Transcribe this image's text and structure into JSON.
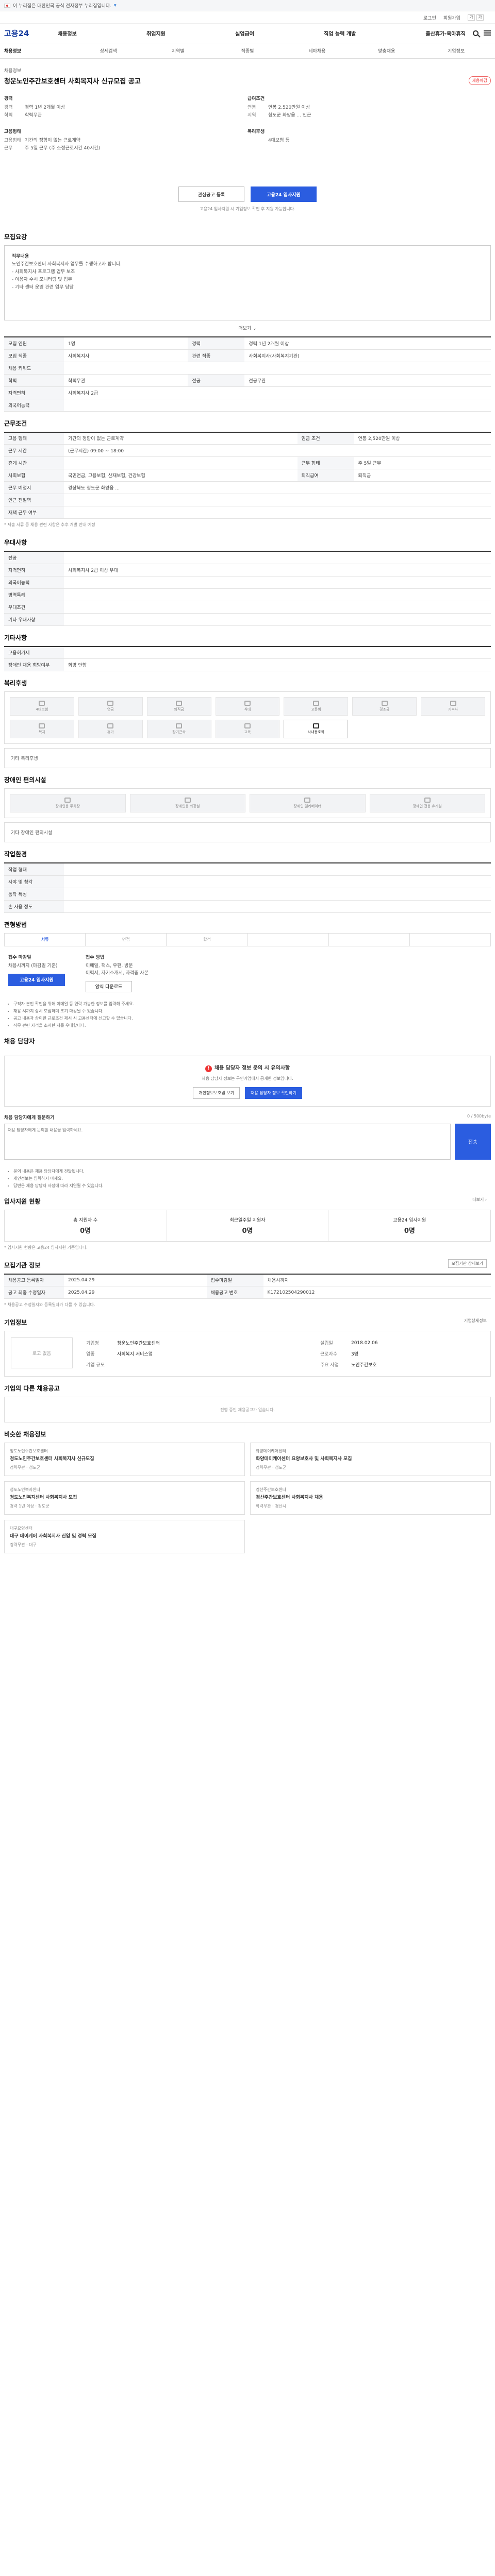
{
  "gov": {
    "text": "이 누리집은 대한민국 공식 전자정부 누리집입니다.",
    "toggle": "▾"
  },
  "util": {
    "login": "로그인",
    "join": "회원가입",
    "font": [
      "가",
      "가"
    ]
  },
  "logo": "고용24",
  "gnb": [
    "채용정보",
    "취업지원",
    "실업급여",
    "직업 능력 개발",
    "출산휴가·육아휴직"
  ],
  "tabs": [
    "채용정보",
    "상세검색",
    "지역별",
    "직종별",
    "테마채용",
    "맞춤채용",
    "기업정보"
  ],
  "title": {
    "company": "채용정보",
    "text": "청운노인주간보호센터 사회복지사 신규모집 공고",
    "badge": "채용마감"
  },
  "summary": {
    "left": [
      {
        "h": "경력",
        "v": [
          {
            "k": "경력",
            "v": "경력 1년 2개월 이상"
          },
          {
            "k": "학력",
            "v": "학력무관"
          }
        ]
      },
      {
        "h": "고용형태",
        "v": [
          {
            "k": "고용형태",
            "v": "기간의 정함이 없는 근로계약"
          },
          {
            "k": "근무",
            "v": "주 5일 근무 (주 소정근로시간 40시간)"
          }
        ]
      }
    ],
    "right": [
      {
        "h": "급여조건",
        "v": [
          {
            "k": "연봉",
            "v": "연봉 2,520만원 이상"
          },
          {
            "k": "지역",
            "v": "청도군 화양읍 ... 인근"
          }
        ]
      },
      {
        "h": "복리후생",
        "v": [
          {
            "k": "",
            "v": "4대보험 등"
          }
        ]
      }
    ]
  },
  "actions": {
    "scrap": "관심공고 등록",
    "apply": "고용24 입사지원",
    "notice": "고용24 입사지원 시 기업정보 확인 후 지원 가능합니다."
  },
  "sec_job": "모집요강",
  "job_desc": [
    "직무내용",
    "노인주간보호센터 사회복지사 업무를 수행하고자 합니다.",
    "- 사회복지사 프로그램 업무 보조",
    "- 이용자 수시 모니터링 및 업무",
    "- 기타 센터 운영 관련 업무 담당"
  ],
  "more": "더보기 ⌄",
  "job_table": [
    [
      "모집 인원",
      "1명",
      "경력",
      "경력 1년 2개월 이상"
    ],
    [
      "모집 직종",
      "사회복지사",
      "관련 직종",
      "사회복지사(사회복지기관)"
    ],
    [
      "채용 키워드",
      "",
      "",
      ""
    ],
    [
      "학력",
      "학력무관",
      "전공",
      "전공무관"
    ],
    [
      "자격면허",
      "사회복지사 2급",
      "",
      ""
    ],
    [
      "외국어능력",
      "",
      "",
      ""
    ]
  ],
  "sec_cond": "근무조건",
  "cond_table": [
    [
      "고용 형태",
      "기간의 정함이 없는 근로계약",
      "임금 조건",
      "연봉 2,520만원 이상"
    ],
    [
      "근무 시간",
      "(근무시간) 09:00 ~ 18:00",
      "",
      ""
    ],
    [
      "휴게 시간",
      "",
      "근무 형태",
      "주 5일 근무"
    ],
    [
      "사회보험",
      "국민연금, 고용보험, 산재보험, 건강보험",
      "퇴직급여",
      "퇴직금"
    ],
    [
      "근무 예정지",
      "경상북도 청도군 화양읍 ...",
      "",
      ""
    ],
    [
      "인근 전철역",
      "",
      "",
      ""
    ],
    [
      "재택 근무 여부",
      "",
      "",
      ""
    ]
  ],
  "map_btn": "지도 보기",
  "cond_note": "* 제출 서류 등 채용 관련 사항은 추후 개별 안내 예정",
  "sec_pref": "우대사항",
  "pref_table": [
    [
      "전공",
      ""
    ],
    [
      "자격면허",
      "사회복지사 2급 이상 우대"
    ],
    [
      "외국어능력",
      ""
    ],
    [
      "병역특례",
      ""
    ],
    [
      "우대조건",
      ""
    ],
    [
      "기타 우대사항",
      ""
    ]
  ],
  "sec_disab": "기타사항",
  "disab_table": [
    [
      "고용허가제",
      ""
    ],
    [
      "장애인 채용 희망여부",
      "희망 안함"
    ]
  ],
  "sec_benef": "복리후생",
  "benef_icons": [
    {
      "name": "4대보험",
      "on": false
    },
    {
      "name": "연금",
      "on": false
    },
    {
      "name": "퇴직금",
      "on": false
    },
    {
      "name": "식대",
      "on": false
    },
    {
      "name": "교통비",
      "on": false
    },
    {
      "name": "경조금",
      "on": false
    },
    {
      "name": "기숙사",
      "on": false
    },
    {
      "name": "복지",
      "on": false
    },
    {
      "name": "휴가",
      "on": false
    },
    {
      "name": "장기근속",
      "on": false
    },
    {
      "name": "교육",
      "on": false
    },
    {
      "name": "사내동호회",
      "on": true
    }
  ],
  "benef_note": "기타 복리후생",
  "sec_barrier": "장애인 편의시설",
  "barrier_icons": [
    {
      "name": "장애인용 주차장"
    },
    {
      "name": "장애인용 화장실"
    },
    {
      "name": "장애인 엘리베이터"
    },
    {
      "name": "장애인 전용 휴게실"
    }
  ],
  "barrier_note": "기타 장애인 편의시설",
  "sec_env": "작업환경",
  "env_table": [
    [
      "작업 형태",
      ""
    ],
    [
      "시야 및 청각",
      ""
    ],
    [
      "동작 특성",
      ""
    ],
    [
      "손 사용 정도",
      ""
    ]
  ],
  "sec_apply": "전형방법",
  "steps": [
    "서류",
    "면접",
    "합격",
    "",
    "",
    ""
  ],
  "apply_info": {
    "deadline_h": "접수 마감일",
    "deadline_v": "채용시까지 (마감일 기준)",
    "method_h": "접수 방법",
    "method_v": [
      "이메일, 팩스, 우편, 방문",
      "",
      "이력서, 자기소개서, 자격증 사본"
    ],
    "submit_btn": "고용24 입사지원",
    "down_btn": "양식 다운로드"
  },
  "notes": [
    "구직자 본인 확인을 위해 이메일 등 연락 가능한 정보를 입력해 주세요.",
    "채용 시까지 상시 모집하며 조기 마감될 수 있습니다.",
    "공고 내용과 상이한 근로조건 제시 시 고용센터에 신고할 수 있습니다.",
    "직무 관련 자격을 소지한 자를 우대합니다."
  ],
  "sec_mgr": "채용 담당자",
  "mgr": {
    "warn": "채용 담당자 정보 문의 시 유의사항",
    "desc": "채용 담당자 정보는 구인기업에서 공개한 정보입니다.",
    "btn1": "개인정보보호법 보기",
    "btn2": "채용 담당자 정보 확인하기"
  },
  "qna": {
    "label": "채용 담당자에게 질문하기",
    "count": "0 / 500byte",
    "placeholder": "채용 담당자에게 문의할 내용을 입력하세요.",
    "btn": "전송"
  },
  "qna_notes": [
    "문의 내용은 채용 담당자에게 전달됩니다.",
    "개인정보는 입력하지 마세요.",
    "답변은 채용 담당자 사정에 따라 지연될 수 있습니다."
  ],
  "sec_stat": "입사지원 현황",
  "stat_more": "더보기 ›",
  "stats": [
    {
      "k": "총 지원자 수",
      "v": "0명"
    },
    {
      "k": "최근일주일 지원자",
      "v": "0명"
    },
    {
      "k": "고용24 입사지원",
      "v": "0명"
    }
  ],
  "stat_note": "* 입사지원 현황은 고용24 입사지원 기준입니다.",
  "sec_info": "모집기관 정보",
  "info_btn": "모집기관 상세보기",
  "info_table": [
    [
      "채용공고 등록일자",
      "2025.04.29",
      "접수마감일",
      "채용시까지"
    ],
    [
      "공고 최종 수정일자",
      "2025.04.29",
      "채용공고 번호",
      "K172102504290012"
    ]
  ],
  "info_note": "* 채용공고 수정일자와 등록일자가 다를 수 있습니다.",
  "sec_company": "기업정보",
  "company": {
    "logo": "로고 없음",
    "rows": [
      [
        "기업명",
        "청운노인주간보호센터",
        "설립일",
        "2018.02.06"
      ],
      [
        "업종",
        "사회복지 서비스업",
        "근로자수",
        "3명"
      ],
      [
        "기업 규모",
        "",
        "주요 사업",
        "노인주간보호"
      ]
    ]
  },
  "company_more": "기업상세정보",
  "sec_other": "기업의 다른 채용공고",
  "other_empty": "진행 중인 채용공고가 없습니다.",
  "sec_similar": "비슷한 채용정보",
  "similar": [
    {
      "c": "청도노인주간보호센터",
      "t": "청도노인주간보호센터 사회복지사 신규모집",
      "m": "경력무관 · 청도군"
    },
    {
      "c": "화양데이케어센터",
      "t": "화양데이케어센터 요양보호사 및 사회복지사 모집",
      "m": "경력무관 · 청도군"
    },
    {
      "c": "청도노인복지센터",
      "t": "청도노인복지센터 사회복지사 모집",
      "m": "경력 1년 이상 · 청도군"
    },
    {
      "c": "경산주간보호센터",
      "t": "경산주간보호센터 사회복지사 채용",
      "m": "학력무관 · 경산시"
    },
    {
      "c": "대구요양센터",
      "t": "대구 데이케어 사회복지사 신입 및 경력 모집",
      "m": "경력무관 · 대구"
    }
  ]
}
